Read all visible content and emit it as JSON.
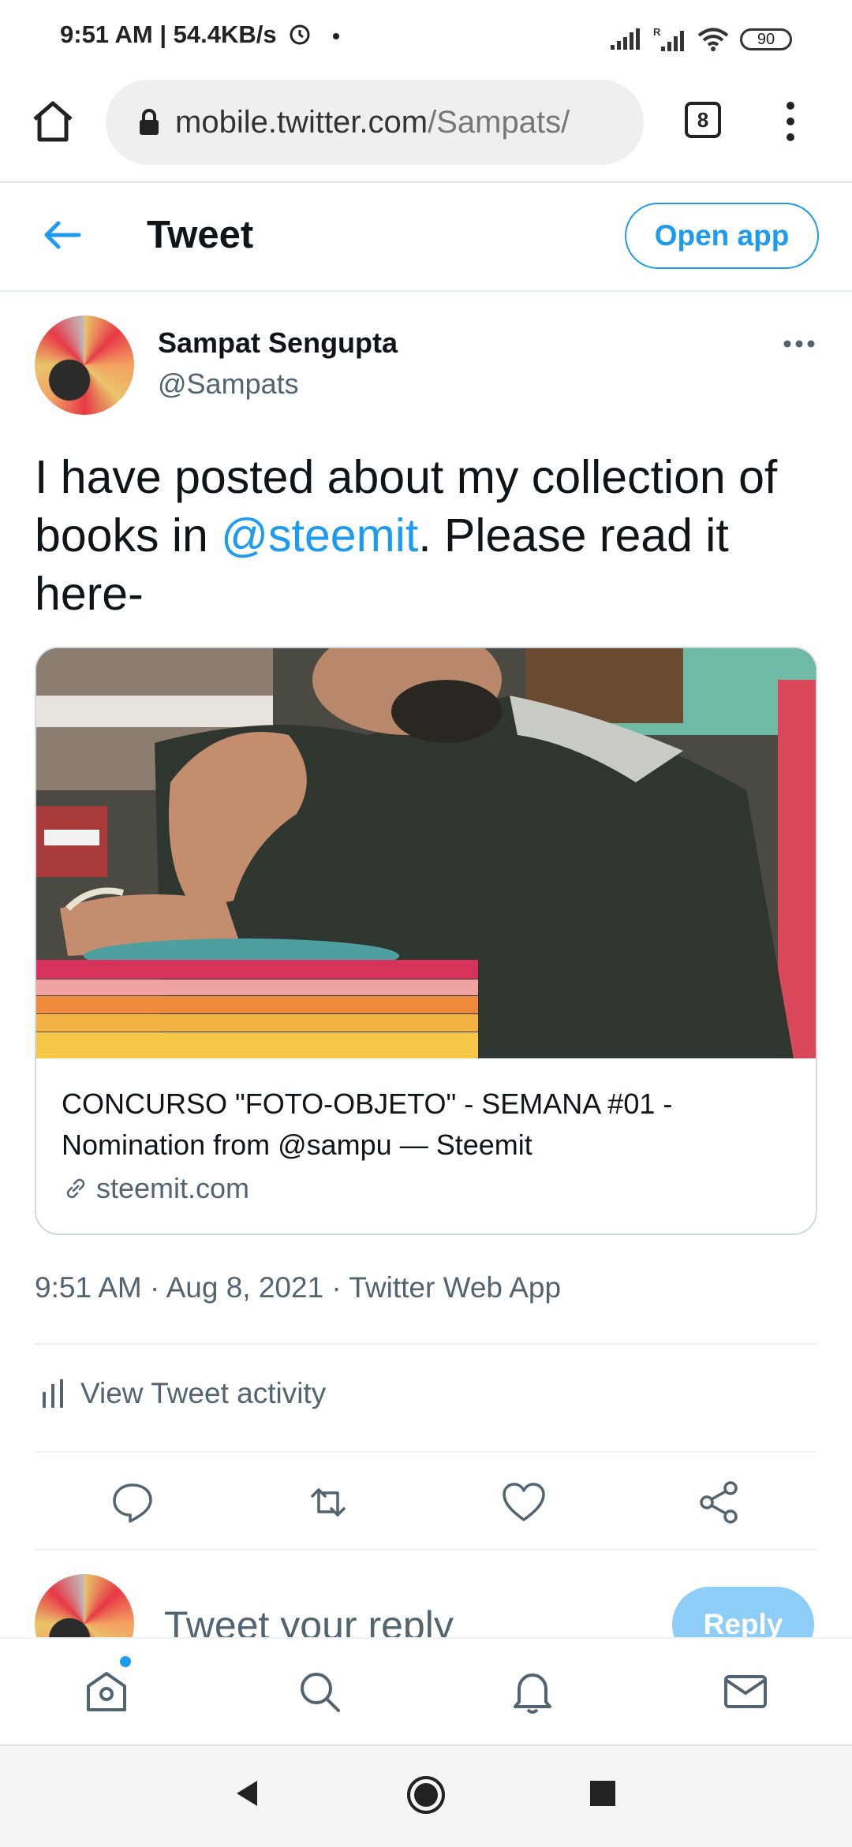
{
  "status_bar": {
    "time": "9:51 AM",
    "net_speed": "54.4KB/s",
    "battery": "90"
  },
  "browser": {
    "url_host": "mobile.twitter.com",
    "url_path": "/Sampats/",
    "tabs_count": "8"
  },
  "header": {
    "title": "Tweet",
    "open_app_label": "Open app"
  },
  "tweet": {
    "author_name": "Sampat Sengupta",
    "author_handle": "@Sampats",
    "text_before": "I have posted about my collection of books in ",
    "mention": "@steemit",
    "text_after": ". Please read it here-",
    "card": {
      "title": "CONCURSO \"FOTO-OBJETO\" - SEMANA #01 - Nomination from @sampu — Steemit",
      "domain": "steemit.com"
    },
    "meta": "9:51 AM · Aug 8, 2021 · Twitter Web App",
    "activity_label": "View Tweet activity"
  },
  "reply": {
    "placeholder": "Tweet your reply",
    "button_label": "Reply"
  },
  "colors": {
    "accent": "#1d9bf0",
    "secondary_text": "#536471",
    "border": "#cfd9de"
  },
  "icons": {
    "status": [
      "alarm-icon",
      "signal-icon",
      "wifi-icon",
      "battery-icon"
    ],
    "browser": [
      "home-icon",
      "lock-icon",
      "tabs-icon",
      "more-vert-icon"
    ],
    "actions": [
      "reply-icon",
      "retweet-icon",
      "like-icon",
      "share-icon"
    ],
    "nav": [
      "home-icon",
      "search-icon",
      "bell-icon",
      "mail-icon"
    ]
  }
}
